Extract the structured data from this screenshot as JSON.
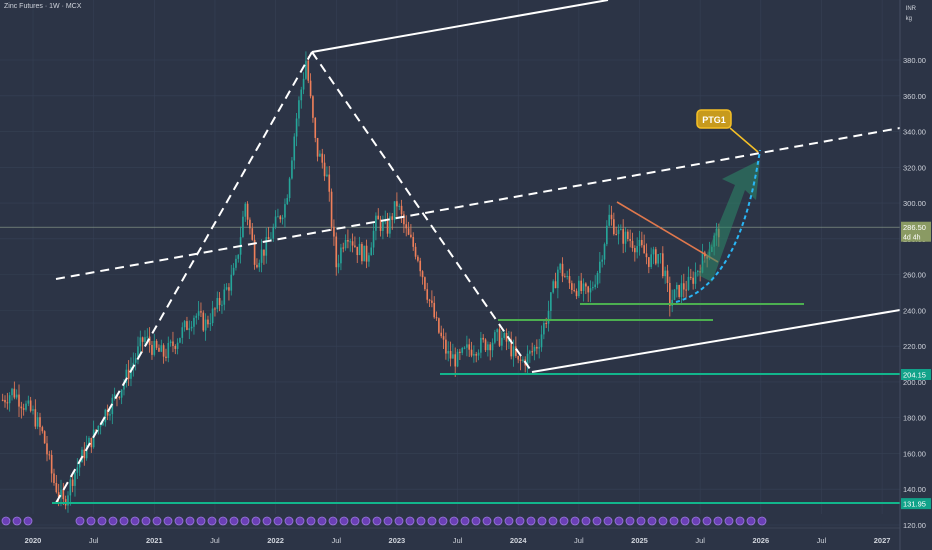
{
  "header": {
    "title": "Zinc Futures · 1W · MCX",
    "currency": "INR",
    "unit": "kg"
  },
  "colors": {
    "background": "#2c3446",
    "up": "#26a69a",
    "down": "#ef7f5a",
    "trendline": "#ffffff",
    "support": "#4caf50",
    "support_teal": "#12b58c",
    "target_arrow": "#2e8b6a",
    "target_curve": "#29b6f6",
    "resistance_line": "#e0784d",
    "ptg_label": "#f5c027"
  },
  "chart_data": {
    "type": "candlestick",
    "symbol": "Zinc Futures",
    "interval": "1W",
    "exchange": "MCX",
    "y_axis": {
      "ticks": [
        "380.00",
        "360.00",
        "340.00",
        "320.00",
        "300.00",
        "280.00",
        "260.00",
        "240.00",
        "220.00",
        "200.00",
        "180.00",
        "160.00",
        "140.00",
        "120.00"
      ],
      "range": [
        118,
        398
      ]
    },
    "x_axis": {
      "ticks": [
        "2020",
        "Jul",
        "2021",
        "Jul",
        "2022",
        "Jul",
        "2023",
        "Jul",
        "2024",
        "Jul",
        "2025",
        "Jul",
        "2026",
        "Jul",
        "2027"
      ],
      "range": [
        "2019-10",
        "2027-01"
      ]
    },
    "last_price": {
      "value": "286.50",
      "countdown": "4d 4h"
    },
    "price_labels": [
      {
        "value": "204.15"
      },
      {
        "value": "131.95"
      }
    ],
    "path_points": [
      [
        "2019-10",
        190
      ],
      [
        "2019-11",
        195
      ],
      [
        "2019-12",
        188
      ],
      [
        "2020-01",
        182
      ],
      [
        "2020-02",
        170
      ],
      [
        "2020-03",
        145
      ],
      [
        "2020-04",
        132
      ],
      [
        "2020-05",
        148
      ],
      [
        "2020-06",
        160
      ],
      [
        "2020-07",
        170
      ],
      [
        "2020-08",
        182
      ],
      [
        "2020-09",
        190
      ],
      [
        "2020-10",
        200
      ],
      [
        "2020-11",
        212
      ],
      [
        "2020-12",
        225
      ],
      [
        "2021-01",
        218
      ],
      [
        "2021-02",
        215
      ],
      [
        "2021-03",
        222
      ],
      [
        "2021-04",
        230
      ],
      [
        "2021-05",
        238
      ],
      [
        "2021-06",
        232
      ],
      [
        "2021-07",
        240
      ],
      [
        "2021-08",
        250
      ],
      [
        "2021-09",
        262
      ],
      [
        "2021-10",
        300
      ],
      [
        "2021-11",
        268
      ],
      [
        "2021-12",
        275
      ],
      [
        "2022-01",
        288
      ],
      [
        "2022-02",
        300
      ],
      [
        "2022-03",
        345
      ],
      [
        "2022-04",
        380
      ],
      [
        "2022-05",
        330
      ],
      [
        "2022-06",
        318
      ],
      [
        "2022-07",
        265
      ],
      [
        "2022-08",
        285
      ],
      [
        "2022-09",
        275
      ],
      [
        "2022-10",
        270
      ],
      [
        "2022-11",
        290
      ],
      [
        "2022-12",
        285
      ],
      [
        "2023-01",
        300
      ],
      [
        "2023-02",
        282
      ],
      [
        "2023-03",
        272
      ],
      [
        "2023-04",
        250
      ],
      [
        "2023-05",
        230
      ],
      [
        "2023-06",
        215
      ],
      [
        "2023-07",
        212
      ],
      [
        "2023-08",
        218
      ],
      [
        "2023-09",
        220
      ],
      [
        "2023-10",
        222
      ],
      [
        "2023-11",
        225
      ],
      [
        "2023-12",
        222
      ],
      [
        "2024-01",
        210
      ],
      [
        "2024-02",
        214
      ],
      [
        "2024-03",
        222
      ],
      [
        "2024-04",
        240
      ],
      [
        "2024-05",
        265
      ],
      [
        "2024-06",
        255
      ],
      [
        "2024-07",
        252
      ],
      [
        "2024-08",
        248
      ],
      [
        "2024-09",
        265
      ],
      [
        "2024-10",
        292
      ],
      [
        "2024-11",
        282
      ],
      [
        "2024-12",
        280
      ],
      [
        "2025-01",
        275
      ],
      [
        "2025-02",
        268
      ],
      [
        "2025-03",
        272
      ],
      [
        "2025-04",
        245
      ],
      [
        "2025-05",
        252
      ],
      [
        "2025-06",
        255
      ],
      [
        "2025-07",
        266
      ],
      [
        "2025-08",
        276
      ],
      [
        "2025-09",
        286.5
      ]
    ],
    "annotations": {
      "target_label": "PTG1"
    },
    "series": []
  }
}
